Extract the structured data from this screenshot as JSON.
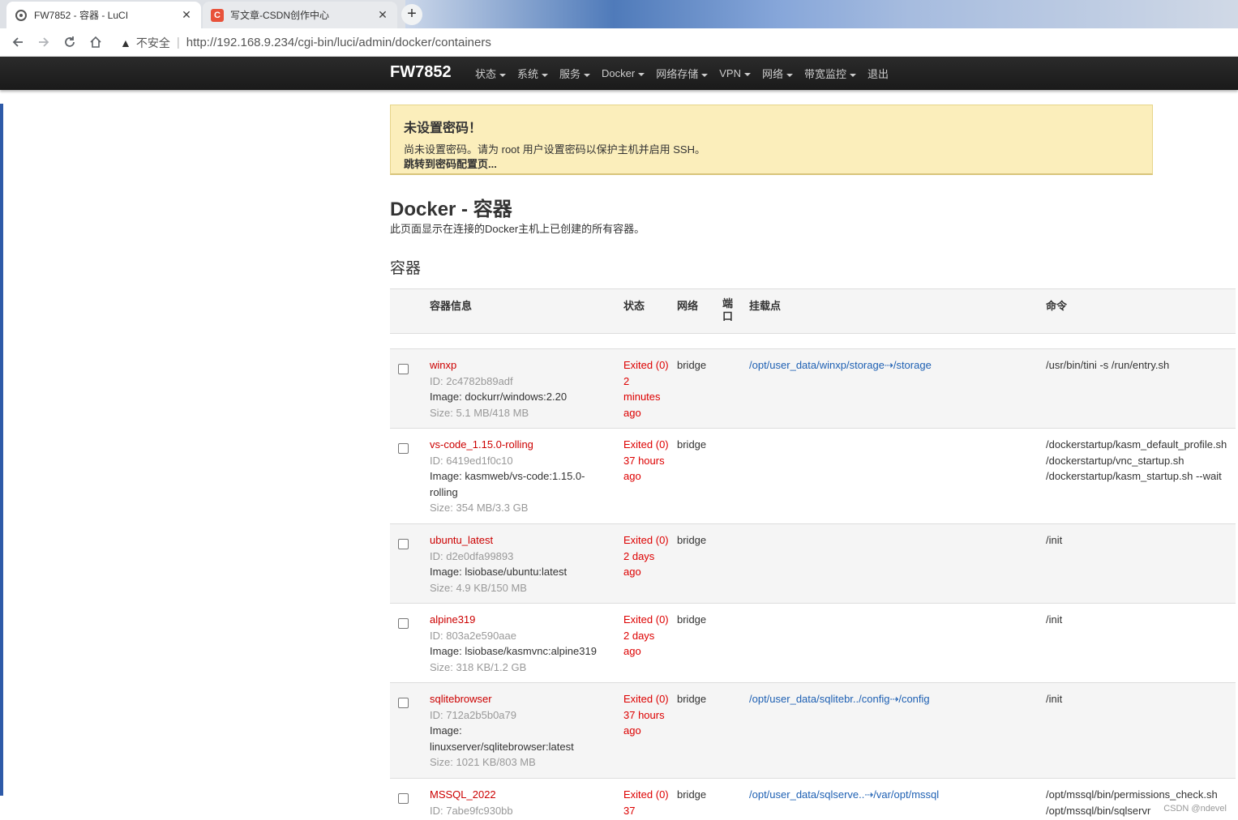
{
  "browser": {
    "tabs": [
      {
        "title": "FW7852 - 容器 - LuCI",
        "close": "✕"
      },
      {
        "title": "写文章-CSDN创作中心",
        "close": "✕"
      }
    ],
    "new_tab": "+",
    "security_label": "不安全",
    "url": "http://192.168.9.234/cgi-bin/luci/admin/docker/containers"
  },
  "header": {
    "brand": "FW7852",
    "menu": [
      "状态",
      "系统",
      "服务",
      "Docker",
      "网络存储",
      "VPN",
      "网络",
      "带宽监控",
      "退出"
    ]
  },
  "alert": {
    "title": "未设置密码！",
    "message": "尚未设置密码。请为 root 用户设置密码以保护主机并启用 SSH。",
    "link": "跳转到密码配置页..."
  },
  "page": {
    "title": "Docker - 容器",
    "description": "此页面显示在连接的Docker主机上已创建的所有容器。",
    "section": "容器"
  },
  "table": {
    "headers": {
      "info": "容器信息",
      "status": "状态",
      "network": "网络",
      "ports": "端口",
      "mounts": "挂载点",
      "command": "命令"
    },
    "rows": [
      {
        "name": "winxp",
        "id": "ID: 2c4782b89adf",
        "image": "Image: dockurr/windows:2.20",
        "size": "Size: 5.1 MB/418 MB",
        "status": "Exited (0) 2 minutes ago",
        "network": "bridge",
        "mounts": "/opt/user_data/winxp/storage⇢/storage",
        "command": "/usr/bin/tini -s /run/entry.sh"
      },
      {
        "name": "vs-code_1.15.0-rolling",
        "id": "ID: 6419ed1f0c10",
        "image": "Image: kasmweb/vs-code:1.15.0-rolling",
        "size": "Size: 354 MB/3.3 GB",
        "status": "Exited (0) 37 hours ago",
        "network": "bridge",
        "mounts": "",
        "command": "/dockerstartup/kasm_default_profile.sh /dockerstartup/vnc_startup.sh /dockerstartup/kasm_startup.sh --wait"
      },
      {
        "name": "ubuntu_latest",
        "id": "ID: d2e0dfa99893",
        "image": "Image: lsiobase/ubuntu:latest",
        "size": "Size: 4.9 KB/150 MB",
        "status": "Exited (0) 2 days ago",
        "network": "bridge",
        "mounts": "",
        "command": "/init"
      },
      {
        "name": "alpine319",
        "id": "ID: 803a2e590aae",
        "image": "Image: lsiobase/kasmvnc:alpine319",
        "size": "Size: 318 KB/1.2 GB",
        "status": "Exited (0) 2 days ago",
        "network": "bridge",
        "mounts": "",
        "command": "/init"
      },
      {
        "name": "sqlitebrowser",
        "id": "ID: 712a2b5b0a79",
        "image": "Image: linuxserver/sqlitebrowser:latest",
        "size": "Size: 1021 KB/803 MB",
        "status": "Exited (0) 37 hours ago",
        "network": "bridge",
        "mounts": "/opt/user_data/sqlitebr../config⇢/config",
        "command": "/init"
      },
      {
        "name": "MSSQL_2022",
        "id": "ID: 7abe9fc930bb",
        "image": "",
        "size": "",
        "status": "Exited (0) 37",
        "network": "bridge",
        "mounts": "/opt/user_data/sqlserve..⇢/var/opt/mssql",
        "command": "/opt/mssql/bin/permissions_check.sh /opt/mssql/bin/sqlservr"
      }
    ]
  },
  "watermark": "CSDN @ndevel"
}
